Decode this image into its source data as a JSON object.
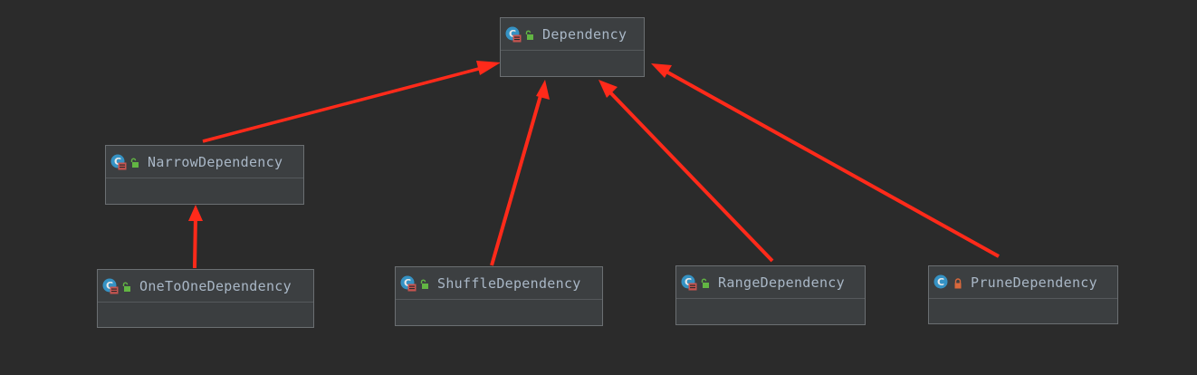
{
  "nodes": {
    "dependency": {
      "label": "Dependency",
      "abstract": true,
      "visibility": "public"
    },
    "narrow": {
      "label": "NarrowDependency",
      "abstract": true,
      "visibility": "public"
    },
    "onetoone": {
      "label": "OneToOneDependency",
      "abstract": false,
      "visibility": "public"
    },
    "shuffle": {
      "label": "ShuffleDependency",
      "abstract": false,
      "visibility": "public"
    },
    "range": {
      "label": "RangeDependency",
      "abstract": false,
      "visibility": "public"
    },
    "prune": {
      "label": "PruneDependency",
      "abstract": false,
      "visibility": "private"
    }
  },
  "edges": [
    {
      "from": "narrow",
      "to": "dependency"
    },
    {
      "from": "shuffle",
      "to": "dependency"
    },
    {
      "from": "range",
      "to": "dependency"
    },
    {
      "from": "prune",
      "to": "dependency"
    },
    {
      "from": "onetoone",
      "to": "narrow"
    }
  ],
  "colors": {
    "background": "#2b2b2b",
    "arrow": "#ff2a1a",
    "class_icon": "#3592c4",
    "abstract_badge": "#c75450",
    "public_lock": "#62b543",
    "private_lock": "#d9683c",
    "label": "#a9b7c6"
  },
  "icons": {
    "class": "class-icon",
    "abstract": "abstract-class-icon",
    "public": "unlocked-icon",
    "private": "locked-icon"
  }
}
